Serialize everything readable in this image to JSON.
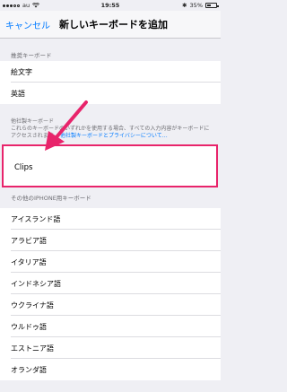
{
  "status_bar": {
    "carrier": "au",
    "time": "19:55",
    "battery_percent": "35%",
    "battery_level": 0.35
  },
  "nav": {
    "cancel_label": "キャンセル",
    "title": "新しいキーボードを追加"
  },
  "suggested": {
    "header": "推奨キーボード",
    "items": [
      "絵文字",
      "英語"
    ]
  },
  "third_party": {
    "footnote_part1": "他社製キーボード",
    "footnote_part2": "これらのキーボードのいずれかを使用する場合、すべての入力内容がキーボードにアクセスされます。",
    "link_text": "他社製キーボードとプライバシーについて…",
    "highlighted_item": "Clips"
  },
  "other": {
    "header": "その他のIPHONE用キーボード",
    "items": [
      "アイスランド語",
      "アラビア語",
      "イタリア語",
      "インドネシア語",
      "ウクライナ語",
      "ウルドゥ語",
      "エストニア語",
      "オランダ語"
    ]
  },
  "colors": {
    "accent": "#007aff",
    "highlight": "#e8246b"
  }
}
